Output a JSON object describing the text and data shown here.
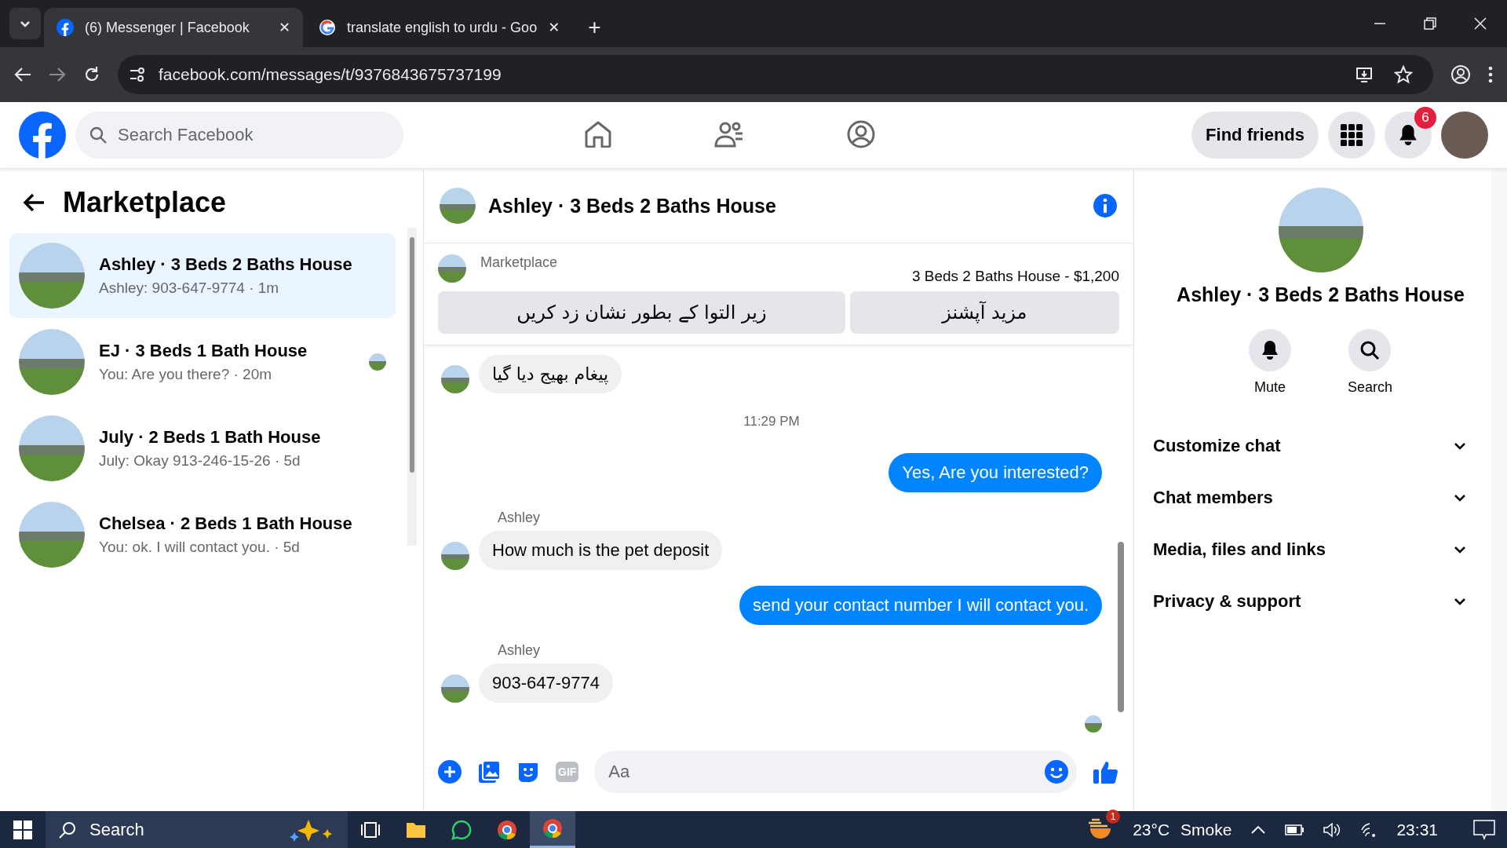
{
  "browser": {
    "tabs": [
      {
        "title": "(6) Messenger | Facebook",
        "kind": "facebook",
        "close": "✕",
        "selected": true
      },
      {
        "title": "translate english to urdu - Goo",
        "kind": "google",
        "close": "✕",
        "selected": false
      }
    ],
    "new_tab": "+",
    "address": "facebook.com/messages/t/9376843675737199"
  },
  "header": {
    "search": {
      "placeholder": "Search Facebook"
    },
    "find_friends": "Find friends",
    "notification_count": "6"
  },
  "sidebar": {
    "title": "Marketplace",
    "conversations": [
      {
        "name": "Ashley · 3 Beds 2 Baths House",
        "preview": "Ashley: 903-647-9774 · 1m",
        "selected": true,
        "seen": false
      },
      {
        "name": "EJ · 3 Beds 1 Bath House",
        "preview": "You: Are you there? · 20m",
        "selected": false,
        "seen": true
      },
      {
        "name": "July · 2 Beds 1 Bath House",
        "preview": "July: Okay 913-246-15-26 · 5d",
        "selected": false,
        "seen": false
      },
      {
        "name": "Chelsea · 2 Beds 1 Bath House",
        "preview": "You: ok. I will contact you. · 5d",
        "selected": false,
        "seen": false
      }
    ]
  },
  "chat": {
    "title": "Ashley · 3 Beds 2 Baths House",
    "listing": {
      "source": "Marketplace",
      "item": "3 Beds 2 Baths House - $1,200",
      "buttons": [
        "مزید آپشنز",
        "زیر التوا کے بطور نشان زد کریں"
      ]
    },
    "messages": [
      {
        "kind": "received",
        "text": "پیغام بھیج دیا گیا"
      },
      {
        "kind": "time",
        "text": "11:29 PM"
      },
      {
        "kind": "sent",
        "text": "Yes, Are you interested?"
      },
      {
        "kind": "received",
        "sender": "Ashley",
        "text": "How much is the pet deposit"
      },
      {
        "kind": "sent",
        "text": "send your contact number I will contact you."
      },
      {
        "kind": "received",
        "sender": "Ashley",
        "text": "903-647-9774"
      }
    ],
    "composer": {
      "gif": "GIF",
      "placeholder": "Aa"
    }
  },
  "details": {
    "title": "Ashley · 3 Beds 2 Baths House",
    "actions": [
      {
        "label": "Mute",
        "kind": "mute"
      },
      {
        "label": "Search",
        "kind": "search"
      }
    ],
    "sections": [
      {
        "label": "Customize chat",
        "expanded": false
      },
      {
        "label": "Chat members",
        "expanded": false
      },
      {
        "label": "Media, files and links",
        "expanded": false
      },
      {
        "label": "Privacy & support",
        "expanded": false
      }
    ]
  },
  "taskbar": {
    "search": "Search",
    "weather_badge": "1",
    "temperature": "23°C",
    "weather": "Smoke",
    "time": "23:31"
  }
}
